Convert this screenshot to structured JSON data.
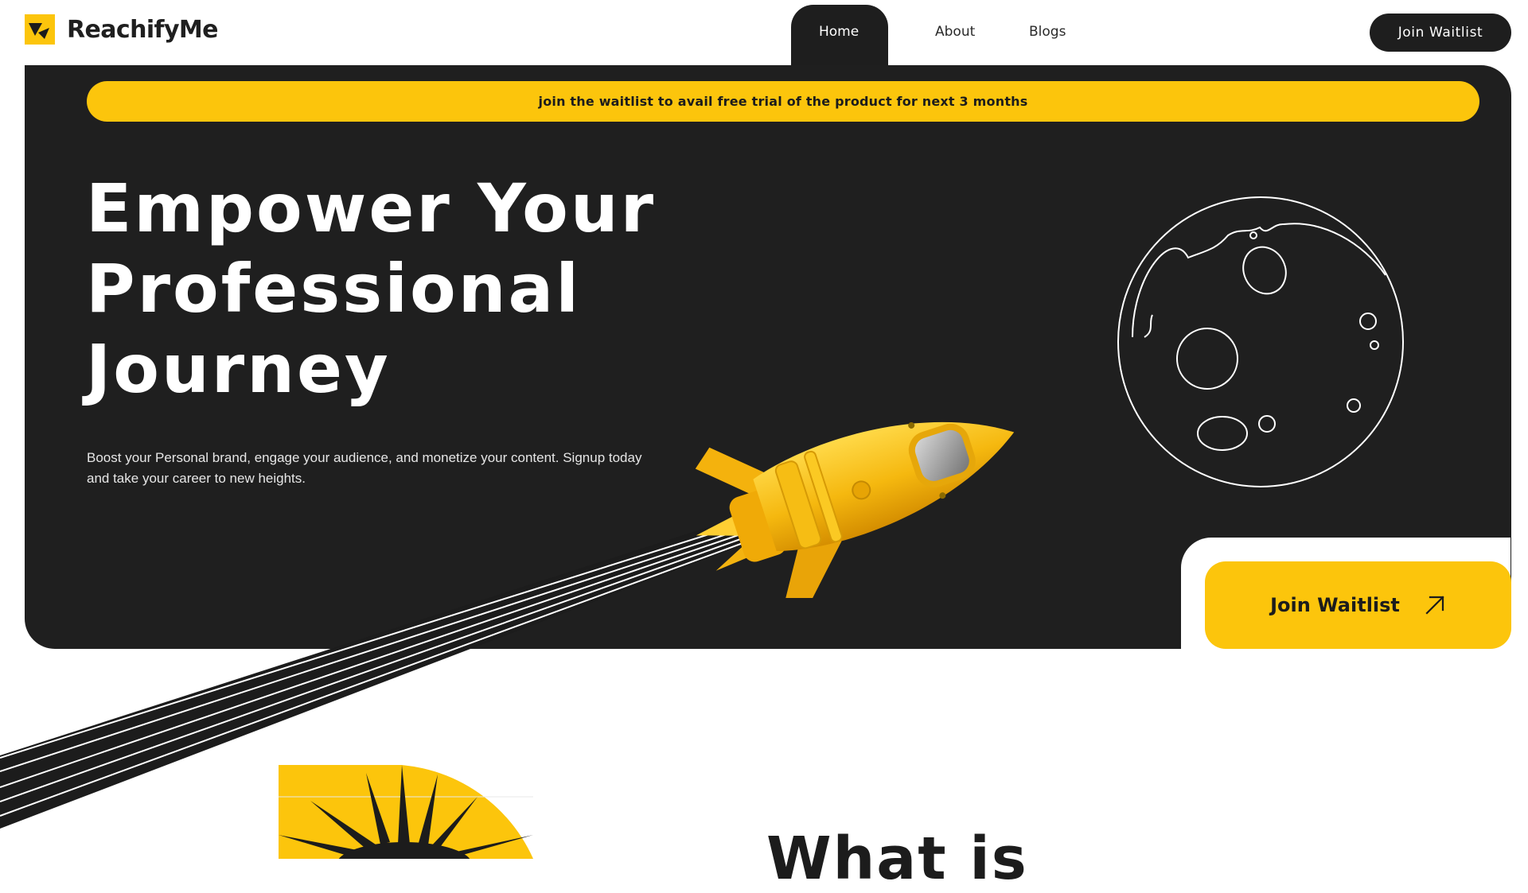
{
  "brand": {
    "name": "ReachifyMe",
    "logo_icon": "reachify-logo-icon",
    "accent": "#fcc50c",
    "dark": "#1f1f1f"
  },
  "nav": {
    "items": [
      {
        "label": "Home",
        "active": true
      },
      {
        "label": "About",
        "active": false
      },
      {
        "label": "Blogs",
        "active": false
      }
    ],
    "cta_label": "Join Waitlist"
  },
  "hero": {
    "promo_text": "join the waitlist to avail free trial of the product for next 3 months",
    "title_lines": [
      "Empower Your",
      "Professional",
      "Journey"
    ],
    "description": "Boost your Personal brand, engage your audience, and monetize your content. Signup today and take your career to new heights.",
    "cta_label": "Join Waitlist",
    "cta_icon": "arrow-up-right-icon",
    "illustrations": [
      "rocket-illustration",
      "moon-outline-illustration"
    ]
  },
  "next_section": {
    "title_fragment": "What is"
  }
}
